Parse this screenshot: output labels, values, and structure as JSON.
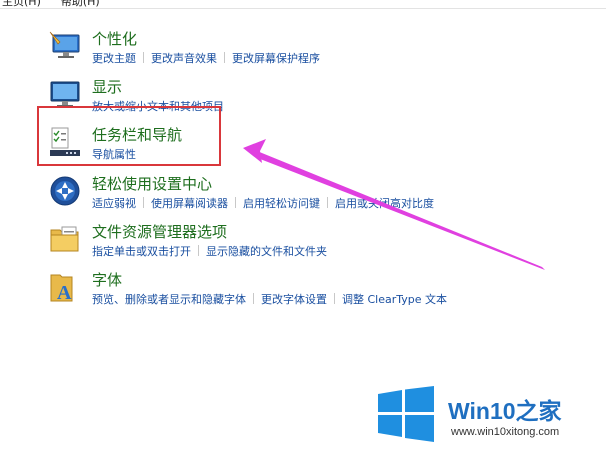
{
  "menu": [
    "主页(H)",
    "帮助(H)"
  ],
  "categories": [
    {
      "title": "个性化",
      "links": [
        "更改主题",
        "更改声音效果",
        "更改屏幕保护程序"
      ]
    },
    {
      "title": "显示",
      "links": [
        "放大或缩小文本和其他项目"
      ]
    },
    {
      "title": "任务栏和导航",
      "links": [
        "导航属性"
      ]
    },
    {
      "title": "轻松使用设置中心",
      "links": [
        "适应弱视",
        "使用屏幕阅读器",
        "启用轻松访问键",
        "启用或关闭高对比度"
      ]
    },
    {
      "title": "文件资源管理器选项",
      "links": [
        "指定单击或双击打开",
        "显示隐藏的文件和文件夹"
      ]
    },
    {
      "title": "字体",
      "links": [
        "预览、删除或者显示和隐藏字体",
        "更改字体设置",
        "调整 ClearType 文本"
      ]
    }
  ],
  "watermark": {
    "brand": "Win10之家",
    "url": "www.win10xitong.com",
    "color": "#1f6fc0"
  },
  "colors": {
    "title": "#1e6e1e",
    "link": "#1a4fa0",
    "highlight": "#d9373b",
    "arrow": "#e040e0"
  }
}
